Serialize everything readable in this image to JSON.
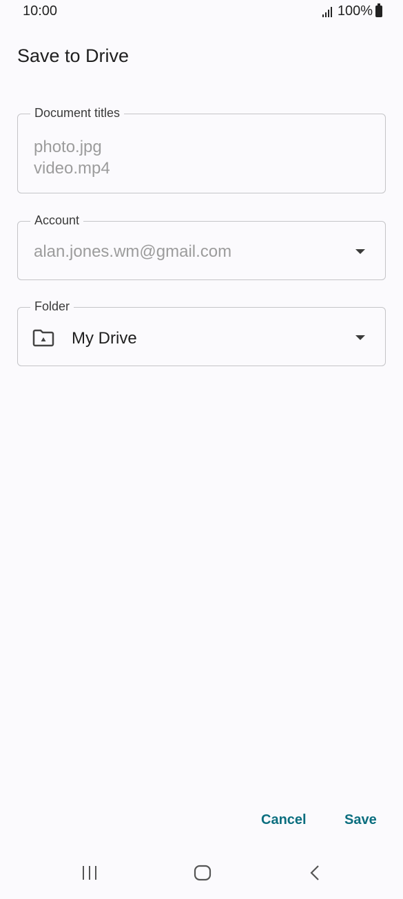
{
  "status_bar": {
    "time": "10:00",
    "battery": "100%"
  },
  "dialog": {
    "title": "Save to Drive",
    "document_titles": {
      "label": "Document titles",
      "values": [
        "photo.jpg",
        "video.mp4"
      ]
    },
    "account": {
      "label": "Account",
      "value": "alan.jones.wm@gmail.com"
    },
    "folder": {
      "label": "Folder",
      "value": "My Drive",
      "icon": "drive-folder-icon"
    },
    "actions": {
      "cancel": "Cancel",
      "save": "Save"
    }
  },
  "nav_bar": {
    "icons": [
      "recent-apps-icon",
      "home-icon",
      "back-icon"
    ]
  }
}
